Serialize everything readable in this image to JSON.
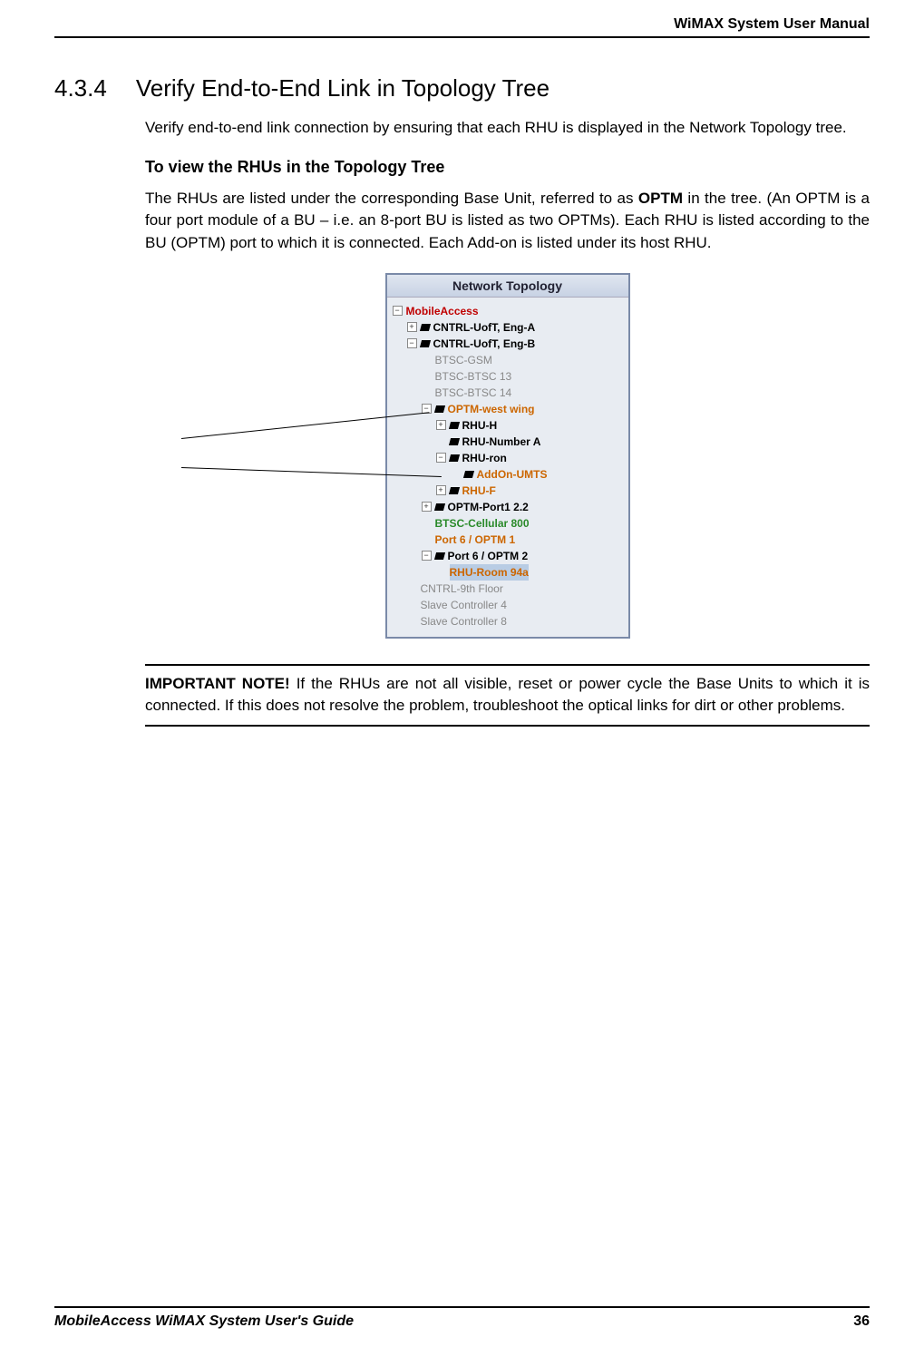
{
  "header": {
    "title": "WiMAX System User Manual"
  },
  "section": {
    "number": "4.3.4",
    "title": "Verify End-to-End Link in Topology Tree",
    "intro": "Verify end-to-end link connection by ensuring that each RHU is displayed in the Network Topology tree.",
    "sub_heading": "To view the RHUs in the Topology Tree",
    "para2_pre": "The RHUs are listed under the corresponding Base Unit, referred to as ",
    "para2_bold": "OPTM",
    "para2_post": " in the tree. (An OPTM is a four port module of a BU – i.e. an 8-port BU is listed as two OPTMs). Each RHU is listed according to the BU (OPTM) port to which it is connected. Each Add-on is listed under its host RHU."
  },
  "topology": {
    "title": "Network Topology",
    "nodes": {
      "root": "MobileAccess",
      "cntrl_a": "CNTRL-UofT, Eng-A",
      "cntrl_b": "CNTRL-UofT, Eng-B",
      "btsc_gsm": "BTSC-GSM",
      "btsc_13": "BTSC-BTSC 13",
      "btsc_14": "BTSC-BTSC 14",
      "optm_west": "OPTM-west wing",
      "rhu_h": "RHU-H",
      "rhu_num_a": "RHU-Number A",
      "rhu_ron": "RHU-ron",
      "addon_umts": "AddOn-UMTS",
      "rhu_f": "RHU-F",
      "optm_port1": "OPTM-Port1 2.2",
      "btsc_cell": "BTSC-Cellular 800",
      "port6_1": "Port 6 / OPTM 1",
      "port6_2": "Port 6 / OPTM 2",
      "rhu_room": "RHU-Room 94a",
      "cntrl_9th": "CNTRL-9th Floor",
      "slave4": "Slave Controller 4",
      "slave8": "Slave Controller 8"
    },
    "expanders": {
      "minus": "−",
      "plus": "+"
    }
  },
  "note": {
    "label": "IMPORTANT NOTE!",
    "text": " If the RHUs are not all visible, reset or power cycle the Base Units to which it is connected. If this does not resolve the problem, troubleshoot the optical links for dirt or other problems."
  },
  "footer": {
    "guide": "MobileAccess WiMAX System User's Guide",
    "page": "36"
  }
}
